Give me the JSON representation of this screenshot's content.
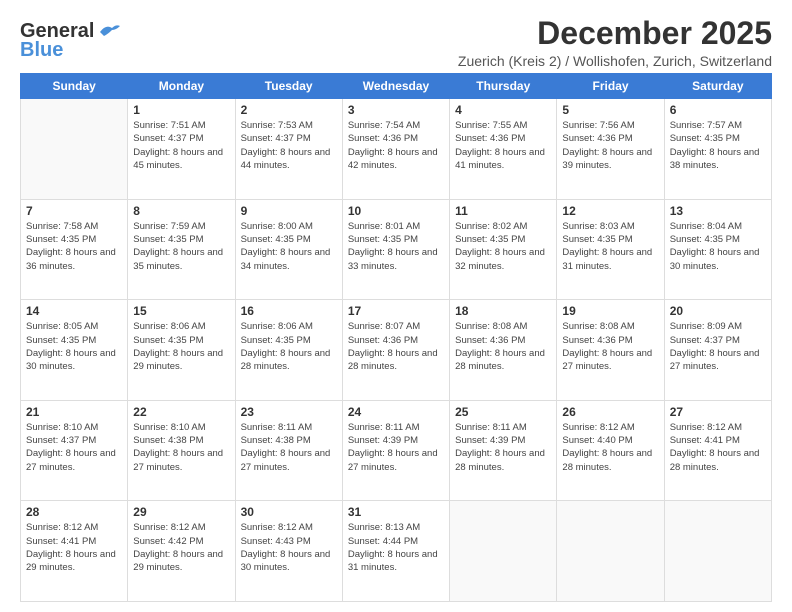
{
  "logo": {
    "general": "General",
    "blue": "Blue"
  },
  "title": "December 2025",
  "subtitle": "Zuerich (Kreis 2) / Wollishofen, Zurich, Switzerland",
  "days_of_week": [
    "Sunday",
    "Monday",
    "Tuesday",
    "Wednesday",
    "Thursday",
    "Friday",
    "Saturday"
  ],
  "weeks": [
    [
      {
        "day": "",
        "sunrise": "",
        "sunset": "",
        "daylight": ""
      },
      {
        "day": "1",
        "sunrise": "Sunrise: 7:51 AM",
        "sunset": "Sunset: 4:37 PM",
        "daylight": "Daylight: 8 hours and 45 minutes."
      },
      {
        "day": "2",
        "sunrise": "Sunrise: 7:53 AM",
        "sunset": "Sunset: 4:37 PM",
        "daylight": "Daylight: 8 hours and 44 minutes."
      },
      {
        "day": "3",
        "sunrise": "Sunrise: 7:54 AM",
        "sunset": "Sunset: 4:36 PM",
        "daylight": "Daylight: 8 hours and 42 minutes."
      },
      {
        "day": "4",
        "sunrise": "Sunrise: 7:55 AM",
        "sunset": "Sunset: 4:36 PM",
        "daylight": "Daylight: 8 hours and 41 minutes."
      },
      {
        "day": "5",
        "sunrise": "Sunrise: 7:56 AM",
        "sunset": "Sunset: 4:36 PM",
        "daylight": "Daylight: 8 hours and 39 minutes."
      },
      {
        "day": "6",
        "sunrise": "Sunrise: 7:57 AM",
        "sunset": "Sunset: 4:35 PM",
        "daylight": "Daylight: 8 hours and 38 minutes."
      }
    ],
    [
      {
        "day": "7",
        "sunrise": "Sunrise: 7:58 AM",
        "sunset": "Sunset: 4:35 PM",
        "daylight": "Daylight: 8 hours and 36 minutes."
      },
      {
        "day": "8",
        "sunrise": "Sunrise: 7:59 AM",
        "sunset": "Sunset: 4:35 PM",
        "daylight": "Daylight: 8 hours and 35 minutes."
      },
      {
        "day": "9",
        "sunrise": "Sunrise: 8:00 AM",
        "sunset": "Sunset: 4:35 PM",
        "daylight": "Daylight: 8 hours and 34 minutes."
      },
      {
        "day": "10",
        "sunrise": "Sunrise: 8:01 AM",
        "sunset": "Sunset: 4:35 PM",
        "daylight": "Daylight: 8 hours and 33 minutes."
      },
      {
        "day": "11",
        "sunrise": "Sunrise: 8:02 AM",
        "sunset": "Sunset: 4:35 PM",
        "daylight": "Daylight: 8 hours and 32 minutes."
      },
      {
        "day": "12",
        "sunrise": "Sunrise: 8:03 AM",
        "sunset": "Sunset: 4:35 PM",
        "daylight": "Daylight: 8 hours and 31 minutes."
      },
      {
        "day": "13",
        "sunrise": "Sunrise: 8:04 AM",
        "sunset": "Sunset: 4:35 PM",
        "daylight": "Daylight: 8 hours and 30 minutes."
      }
    ],
    [
      {
        "day": "14",
        "sunrise": "Sunrise: 8:05 AM",
        "sunset": "Sunset: 4:35 PM",
        "daylight": "Daylight: 8 hours and 30 minutes."
      },
      {
        "day": "15",
        "sunrise": "Sunrise: 8:06 AM",
        "sunset": "Sunset: 4:35 PM",
        "daylight": "Daylight: 8 hours and 29 minutes."
      },
      {
        "day": "16",
        "sunrise": "Sunrise: 8:06 AM",
        "sunset": "Sunset: 4:35 PM",
        "daylight": "Daylight: 8 hours and 28 minutes."
      },
      {
        "day": "17",
        "sunrise": "Sunrise: 8:07 AM",
        "sunset": "Sunset: 4:36 PM",
        "daylight": "Daylight: 8 hours and 28 minutes."
      },
      {
        "day": "18",
        "sunrise": "Sunrise: 8:08 AM",
        "sunset": "Sunset: 4:36 PM",
        "daylight": "Daylight: 8 hours and 28 minutes."
      },
      {
        "day": "19",
        "sunrise": "Sunrise: 8:08 AM",
        "sunset": "Sunset: 4:36 PM",
        "daylight": "Daylight: 8 hours and 27 minutes."
      },
      {
        "day": "20",
        "sunrise": "Sunrise: 8:09 AM",
        "sunset": "Sunset: 4:37 PM",
        "daylight": "Daylight: 8 hours and 27 minutes."
      }
    ],
    [
      {
        "day": "21",
        "sunrise": "Sunrise: 8:10 AM",
        "sunset": "Sunset: 4:37 PM",
        "daylight": "Daylight: 8 hours and 27 minutes."
      },
      {
        "day": "22",
        "sunrise": "Sunrise: 8:10 AM",
        "sunset": "Sunset: 4:38 PM",
        "daylight": "Daylight: 8 hours and 27 minutes."
      },
      {
        "day": "23",
        "sunrise": "Sunrise: 8:11 AM",
        "sunset": "Sunset: 4:38 PM",
        "daylight": "Daylight: 8 hours and 27 minutes."
      },
      {
        "day": "24",
        "sunrise": "Sunrise: 8:11 AM",
        "sunset": "Sunset: 4:39 PM",
        "daylight": "Daylight: 8 hours and 27 minutes."
      },
      {
        "day": "25",
        "sunrise": "Sunrise: 8:11 AM",
        "sunset": "Sunset: 4:39 PM",
        "daylight": "Daylight: 8 hours and 28 minutes."
      },
      {
        "day": "26",
        "sunrise": "Sunrise: 8:12 AM",
        "sunset": "Sunset: 4:40 PM",
        "daylight": "Daylight: 8 hours and 28 minutes."
      },
      {
        "day": "27",
        "sunrise": "Sunrise: 8:12 AM",
        "sunset": "Sunset: 4:41 PM",
        "daylight": "Daylight: 8 hours and 28 minutes."
      }
    ],
    [
      {
        "day": "28",
        "sunrise": "Sunrise: 8:12 AM",
        "sunset": "Sunset: 4:41 PM",
        "daylight": "Daylight: 8 hours and 29 minutes."
      },
      {
        "day": "29",
        "sunrise": "Sunrise: 8:12 AM",
        "sunset": "Sunset: 4:42 PM",
        "daylight": "Daylight: 8 hours and 29 minutes."
      },
      {
        "day": "30",
        "sunrise": "Sunrise: 8:12 AM",
        "sunset": "Sunset: 4:43 PM",
        "daylight": "Daylight: 8 hours and 30 minutes."
      },
      {
        "day": "31",
        "sunrise": "Sunrise: 8:13 AM",
        "sunset": "Sunset: 4:44 PM",
        "daylight": "Daylight: 8 hours and 31 minutes."
      },
      {
        "day": "",
        "sunrise": "",
        "sunset": "",
        "daylight": ""
      },
      {
        "day": "",
        "sunrise": "",
        "sunset": "",
        "daylight": ""
      },
      {
        "day": "",
        "sunrise": "",
        "sunset": "",
        "daylight": ""
      }
    ]
  ]
}
